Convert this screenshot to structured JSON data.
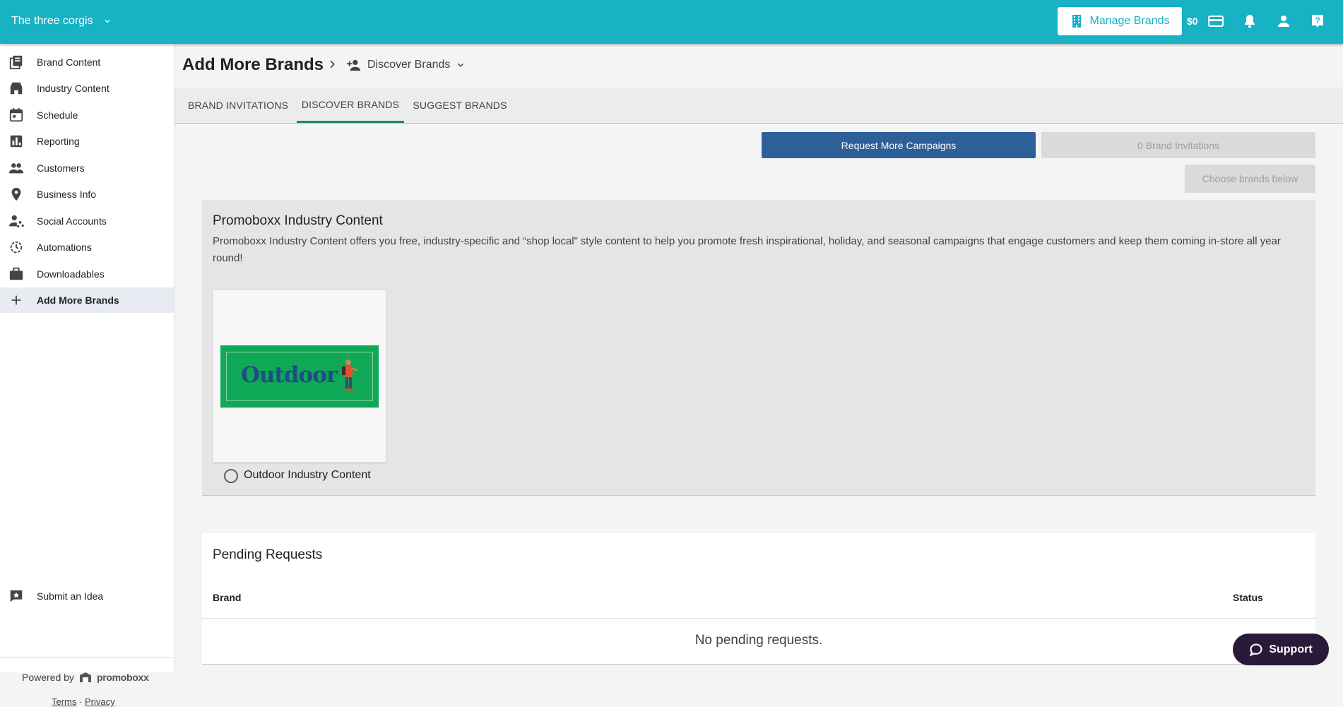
{
  "topbar": {
    "account_name": "The three corgis",
    "manage_brands_label": "Manage Brands",
    "balance": "$0",
    "brand_color": "#17b2c4"
  },
  "sidebar": {
    "items": [
      {
        "label": "Brand Content",
        "icon": "library-icon"
      },
      {
        "label": "Industry Content",
        "icon": "store-icon"
      },
      {
        "label": "Schedule",
        "icon": "calendar-icon"
      },
      {
        "label": "Reporting",
        "icon": "bar-chart-icon"
      },
      {
        "label": "Customers",
        "icon": "people-icon"
      },
      {
        "label": "Business Info",
        "icon": "location-pin-icon"
      },
      {
        "label": "Social Accounts",
        "icon": "person-share-icon"
      },
      {
        "label": "Automations",
        "icon": "automation-icon"
      },
      {
        "label": "Downloadables",
        "icon": "briefcase-icon"
      },
      {
        "label": "Add More Brands",
        "icon": "plus-icon"
      }
    ],
    "submit_idea": "Submit an Idea",
    "powered_by": "Powered by",
    "powered_brand": "promoboxx",
    "terms": "Terms",
    "legal_separator": "·",
    "privacy": "Privacy"
  },
  "header": {
    "title": "Add More Brands",
    "crumb": "Discover Brands"
  },
  "tabs": [
    {
      "label": "BRAND INVITATIONS",
      "active": false
    },
    {
      "label": "DISCOVER BRANDS",
      "active": true
    },
    {
      "label": "SUGGEST BRANDS",
      "active": false
    }
  ],
  "actions": {
    "request_campaigns": "Request More Campaigns",
    "brand_invitations": "0 Brand Invitations",
    "choose_brands": "Choose brands below"
  },
  "industry": {
    "title": "Promoboxx Industry Content",
    "description": "Promoboxx Industry Content offers you free, industry-specific and “shop local” style content to help you promote fresh inspirational, holiday, and seasonal campaigns that engage customers and keep them coming in-store all year round!",
    "card_logo_text": "Outdoor",
    "card_label": "Outdoor Industry Content"
  },
  "pending": {
    "title": "Pending Requests",
    "col_brand": "Brand",
    "col_status": "Status",
    "empty_message": "No pending requests."
  },
  "support": {
    "label": "Support"
  }
}
